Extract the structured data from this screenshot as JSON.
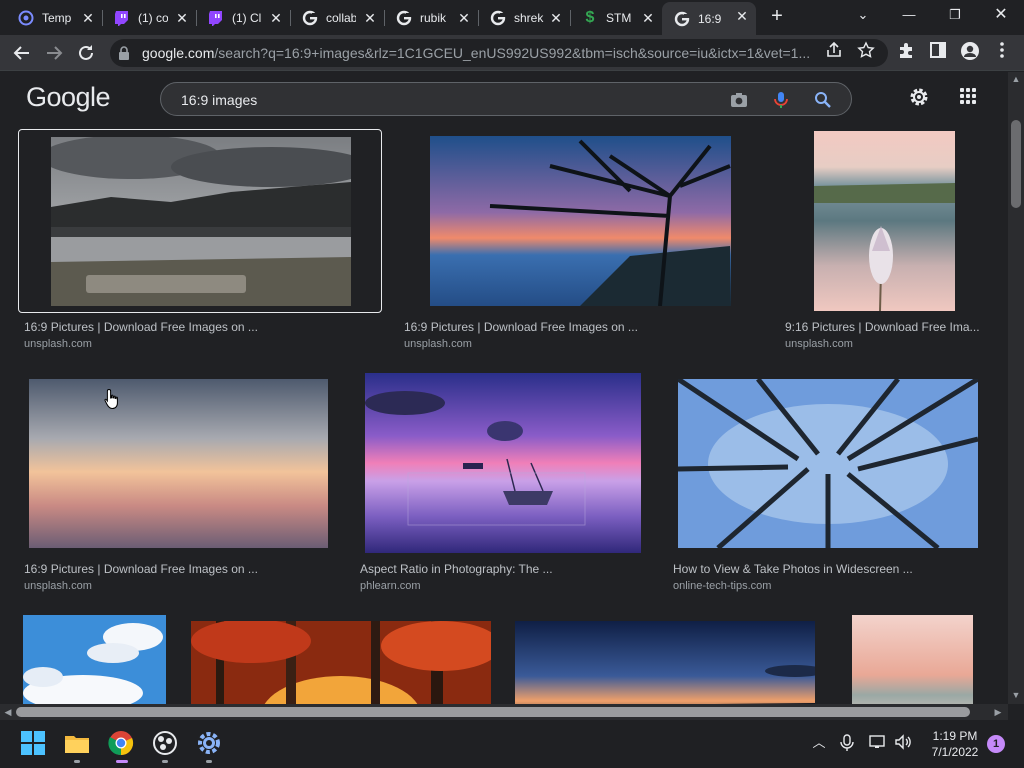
{
  "browser": {
    "tabs": [
      {
        "title": "Temp",
        "favicon": "circle-at-icon"
      },
      {
        "title": "(1) co",
        "favicon": "twitch-icon"
      },
      {
        "title": "(1) Cl",
        "favicon": "twitch-icon"
      },
      {
        "title": "collab",
        "favicon": "google-icon"
      },
      {
        "title": "rubik",
        "favicon": "google-icon"
      },
      {
        "title": "shrek",
        "favicon": "google-icon"
      },
      {
        "title": "STM",
        "favicon": "dollar-icon"
      },
      {
        "title": "16:9",
        "favicon": "google-icon",
        "active": true
      }
    ],
    "url_host": "google.com",
    "url_path": "/search?q=16:9+images&rlz=1C1GCEU_enUS992US992&tbm=isch&source=iu&ictx=1&vet=1..."
  },
  "google": {
    "logo": "Google",
    "query": "16:9 images"
  },
  "results": [
    {
      "title": "16:9 Pictures | Download Free Images on ...",
      "source": "unsplash.com"
    },
    {
      "title": "16:9 Pictures | Download Free Images on ...",
      "source": "unsplash.com"
    },
    {
      "title": "9:16 Pictures | Download Free Ima...",
      "source": "unsplash.com"
    },
    {
      "title": "16:9 Pictures | Download Free Images on ...",
      "source": "unsplash.com"
    },
    {
      "title": "Aspect Ratio in Photography: The ...",
      "source": "phlearn.com"
    },
    {
      "title": "How to View & Take Photos in Widescreen ...",
      "source": "online-tech-tips.com"
    }
  ],
  "taskbar": {
    "time": "1:19 PM",
    "date": "7/1/2022",
    "notifications": "1"
  },
  "colors": {
    "background": "#202124",
    "toolbar": "#35363a",
    "text": "#e8eaed",
    "subtext": "#9aa0a6"
  }
}
